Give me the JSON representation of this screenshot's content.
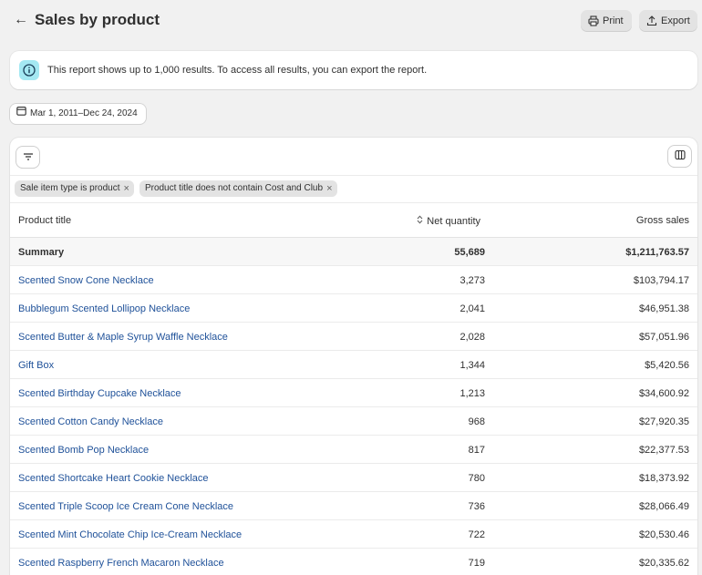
{
  "header": {
    "title": "Sales by product",
    "back_icon": "arrow-left-icon",
    "print_label": "Print",
    "export_label": "Export"
  },
  "banner": {
    "icon": "info-icon",
    "text": "This report shows up to 1,000 results. To access all results, you can export the report."
  },
  "date_range": {
    "icon": "calendar-icon",
    "label": "Mar 1, 2011–Dec 24, 2024"
  },
  "filters": [
    {
      "label": "Sale item type is product"
    },
    {
      "label": "Product title does not contain Cost and Club"
    }
  ],
  "table": {
    "columns": {
      "title": "Product title",
      "net_quantity": "Net quantity",
      "gross_sales": "Gross sales"
    },
    "summary": {
      "title": "Summary",
      "net_quantity": "55,689",
      "gross_sales": "$1,211,763.57"
    },
    "rows": [
      {
        "title": "Scented Snow Cone Necklace",
        "net_quantity": "3,273",
        "gross_sales": "$103,794.17"
      },
      {
        "title": "Bubblegum Scented Lollipop Necklace",
        "net_quantity": "2,041",
        "gross_sales": "$46,951.38"
      },
      {
        "title": "Scented Butter & Maple Syrup Waffle Necklace",
        "net_quantity": "2,028",
        "gross_sales": "$57,051.96"
      },
      {
        "title": "Gift Box",
        "net_quantity": "1,344",
        "gross_sales": "$5,420.56"
      },
      {
        "title": "Scented Birthday Cupcake Necklace",
        "net_quantity": "1,213",
        "gross_sales": "$34,600.92"
      },
      {
        "title": "Scented Cotton Candy Necklace",
        "net_quantity": "968",
        "gross_sales": "$27,920.35"
      },
      {
        "title": "Scented Bomb Pop Necklace",
        "net_quantity": "817",
        "gross_sales": "$22,377.53"
      },
      {
        "title": "Scented Shortcake Heart Cookie Necklace",
        "net_quantity": "780",
        "gross_sales": "$18,373.92"
      },
      {
        "title": "Scented Triple Scoop Ice Cream Cone Necklace",
        "net_quantity": "736",
        "gross_sales": "$28,066.49"
      },
      {
        "title": "Scented Mint Chocolate Chip Ice-Cream Necklace",
        "net_quantity": "722",
        "gross_sales": "$20,530.46"
      },
      {
        "title": "Scented Raspberry French Macaron Necklace",
        "net_quantity": "719",
        "gross_sales": "$20,335.62"
      }
    ]
  },
  "colors": {
    "link": "#1f5199",
    "background": "#f1f1f1",
    "info_accent": "#a4e8f2"
  }
}
